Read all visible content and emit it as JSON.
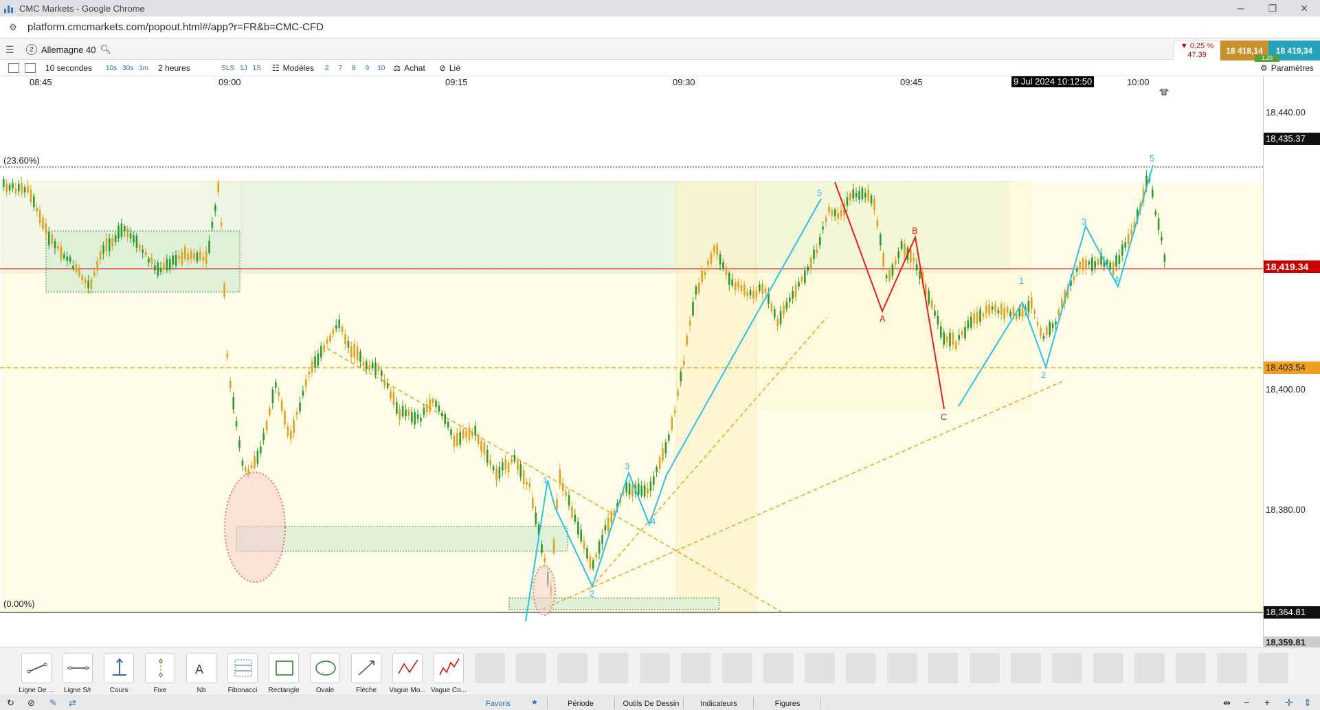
{
  "window": {
    "title": "CMC Markets - Google Chrome",
    "url": "platform.cmcmarkets.com/popout.html#/app?r=FR&b=CMC-CFD"
  },
  "instrument": {
    "index": "2",
    "name": "Allemagne 40"
  },
  "quote": {
    "change_pct": "▼ 0.25 %",
    "change_pts": "47.39",
    "sell": "18 418,14",
    "buy": "18 419,34",
    "spread": "1.20"
  },
  "toolbar": {
    "interval": "10 secondes",
    "intervals": [
      "10s",
      "30s",
      "1m"
    ],
    "range": "2 heures",
    "ranges": [
      "SLS",
      "1J",
      "1S"
    ],
    "models": "Modèles",
    "counts": [
      "2",
      "7",
      "8",
      "9",
      "10"
    ],
    "buy": "Achat",
    "linked": "Lié",
    "params": "Paramètres"
  },
  "time_axis": {
    "labels": [
      "08:45",
      "09:00",
      "09:15",
      "09:30",
      "09:45",
      "10:00"
    ],
    "cursor": "9 Jul 2024 10:12:50"
  },
  "price_axis": {
    "ticks": [
      "18,440.00",
      "18,400.00",
      "18,380.00"
    ],
    "markers": {
      "fib_high": "18,435.37",
      "current": "18,419.34",
      "level": "18,403.54",
      "fib_low": "18,364.81",
      "bottom": "18,359.81"
    }
  },
  "fib": {
    "top": "(23.60%)",
    "bottom": "(0.00%)"
  },
  "waves": {
    "blue1": [
      "1",
      "2",
      "3",
      "4",
      "5"
    ],
    "red": [
      "A",
      "B",
      "C"
    ],
    "blue2": [
      "1",
      "2",
      "3",
      "4",
      "5"
    ]
  },
  "tools": [
    {
      "label": "Ligne De ...",
      "icon": "trend-line-icon"
    },
    {
      "label": "Ligne S/r",
      "icon": "sr-line-icon"
    },
    {
      "label": "Cours",
      "icon": "price-icon"
    },
    {
      "label": "Fixe",
      "icon": "fixed-icon"
    },
    {
      "label": "Nb",
      "icon": "text-icon"
    },
    {
      "label": "Fibonacci",
      "icon": "fibonacci-icon"
    },
    {
      "label": "Rectangle",
      "icon": "rectangle-icon"
    },
    {
      "label": "Ovale",
      "icon": "oval-icon"
    },
    {
      "label": "Flèche",
      "icon": "arrow-icon"
    },
    {
      "label": "Vague Mo...",
      "icon": "wave-icon"
    },
    {
      "label": "Vague Co...",
      "icon": "wave-complex-icon"
    }
  ],
  "tabs": [
    "Favoris",
    "Période",
    "Outils De Dessin",
    "Indicateurs",
    "Figures"
  ],
  "colors": {
    "candle": "#2e9a2e",
    "candle_down": "#e0a020",
    "fib_line": "#f0a020",
    "red_wave": "#e02020",
    "blue_wave": "#29c3e6",
    "current_line": "#d00000"
  }
}
